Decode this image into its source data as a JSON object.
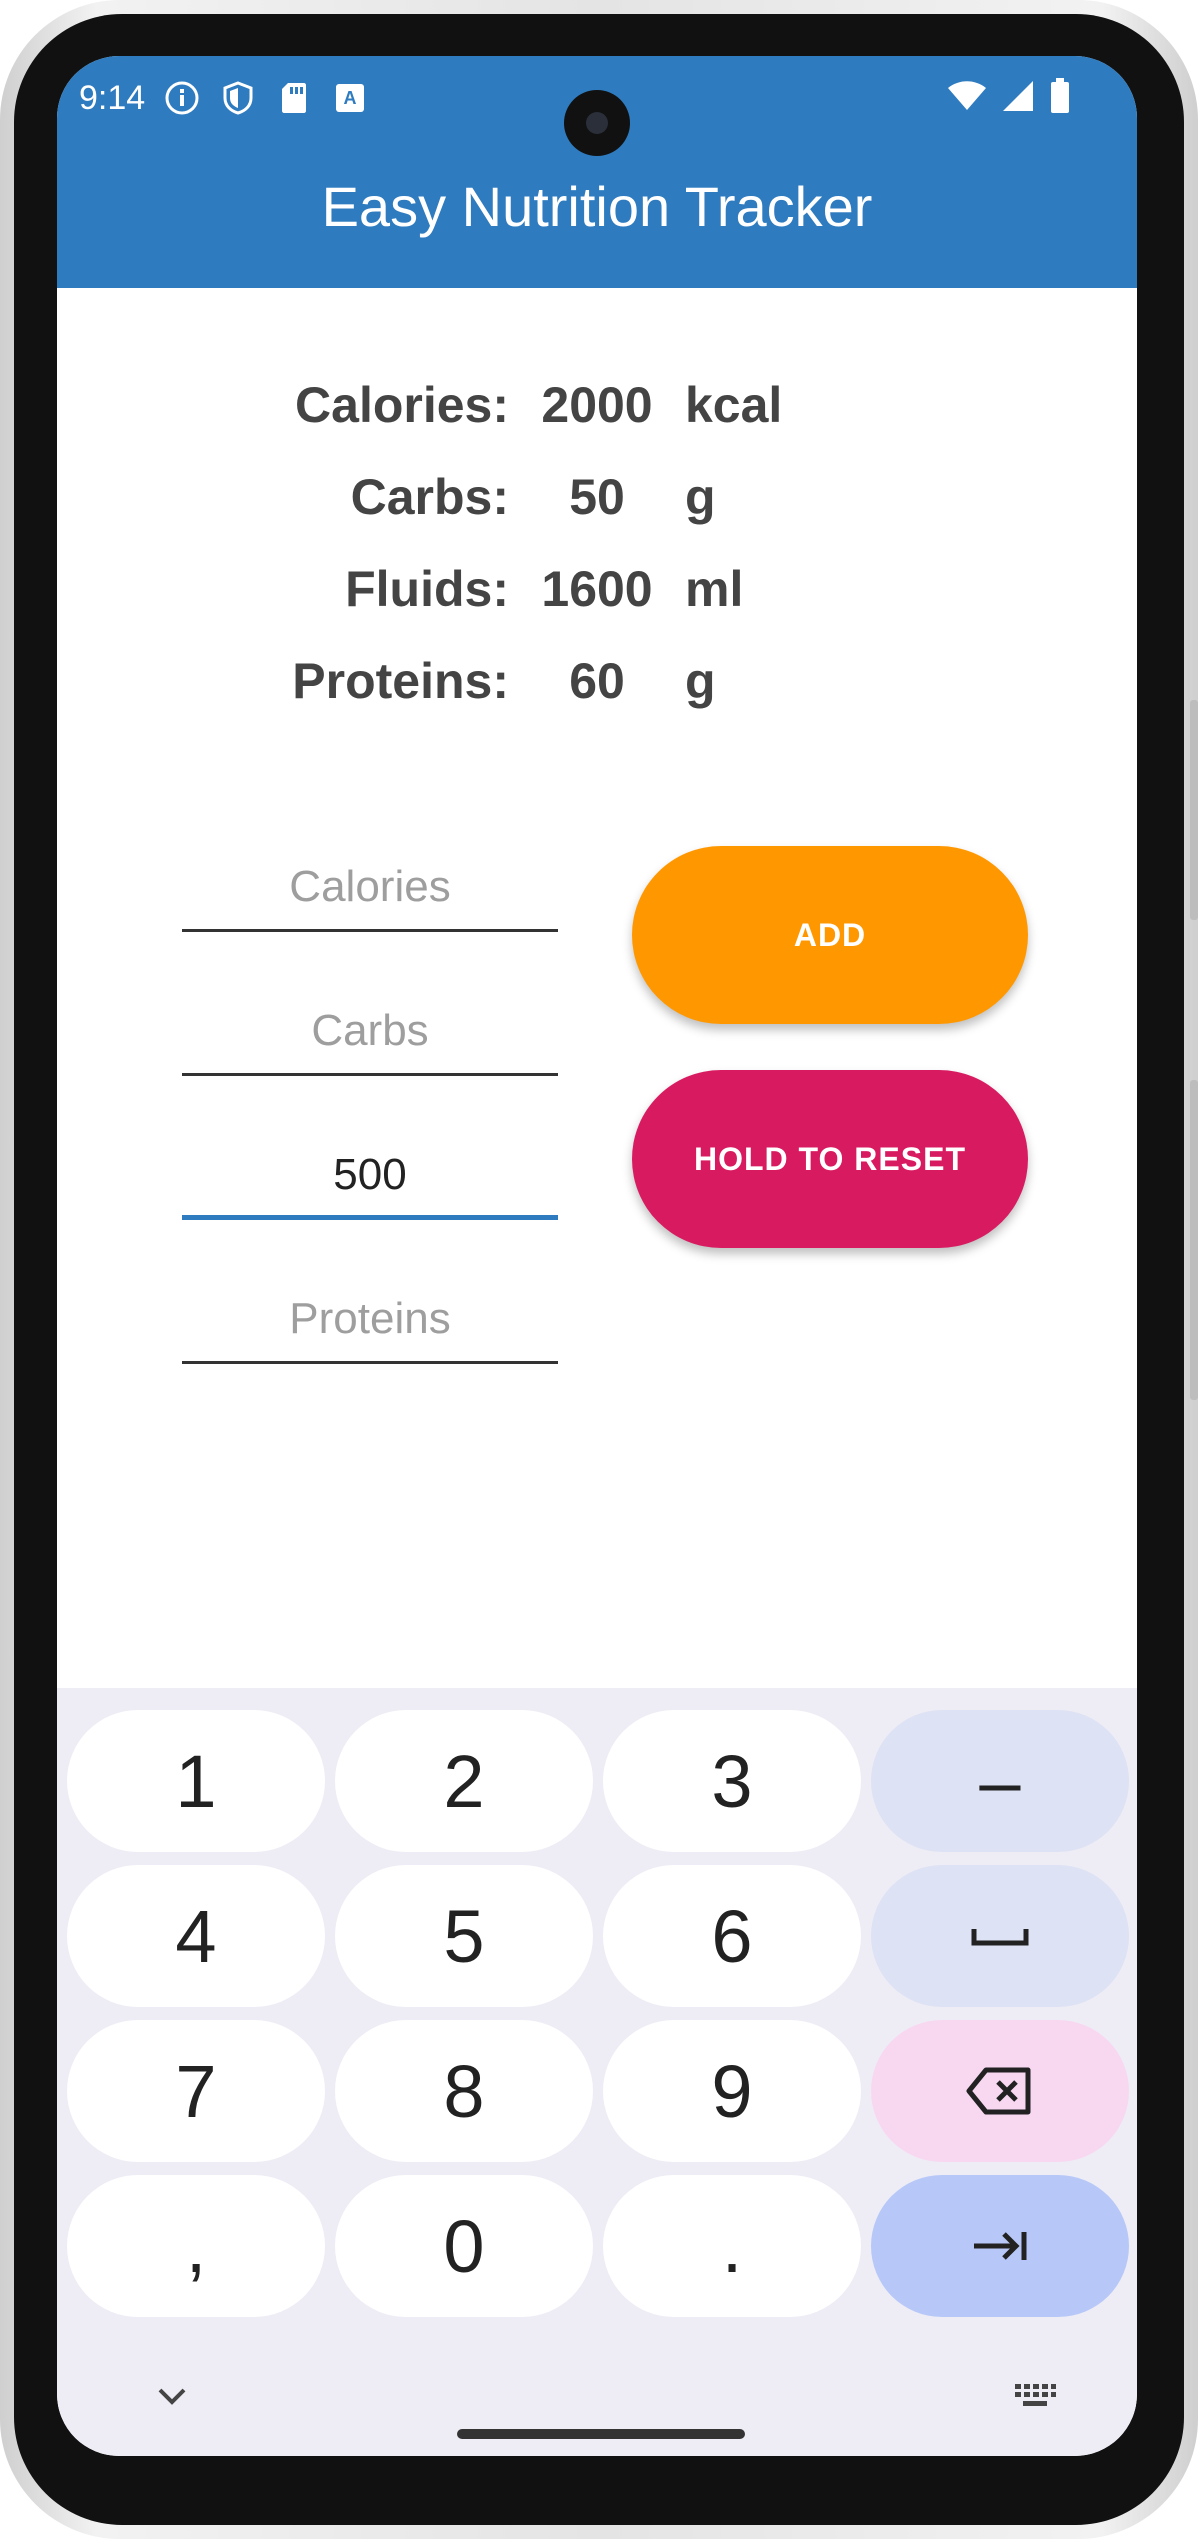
{
  "status_bar": {
    "time": "9:14"
  },
  "app": {
    "title": "Easy Nutrition Tracker"
  },
  "summary": [
    {
      "label": "Calories:",
      "value": "2000",
      "unit": "kcal"
    },
    {
      "label": "Carbs:",
      "value": "50",
      "unit": "g"
    },
    {
      "label": "Fluids:",
      "value": "1600",
      "unit": "ml"
    },
    {
      "label": "Proteins:",
      "value": "60",
      "unit": "g"
    }
  ],
  "inputs": {
    "calories": {
      "placeholder": "Calories",
      "value": ""
    },
    "carbs": {
      "placeholder": "Carbs",
      "value": ""
    },
    "fluids": {
      "placeholder": "",
      "value": "500"
    },
    "proteins": {
      "placeholder": "Proteins",
      "value": ""
    }
  },
  "buttons": {
    "add": "ADD",
    "reset": "HOLD TO RESET"
  },
  "keyboard": {
    "rows": [
      [
        "1",
        "2",
        "3",
        "–"
      ],
      [
        "4",
        "5",
        "6",
        "space"
      ],
      [
        "7",
        "8",
        "9",
        "backspace"
      ],
      [
        ",",
        "0",
        ".",
        "tab"
      ]
    ]
  },
  "colors": {
    "app_bar": "#2e7bbf",
    "add_button": "#ff9800",
    "reset_button": "#d81b60",
    "focused_underline": "#2e7bbf"
  }
}
